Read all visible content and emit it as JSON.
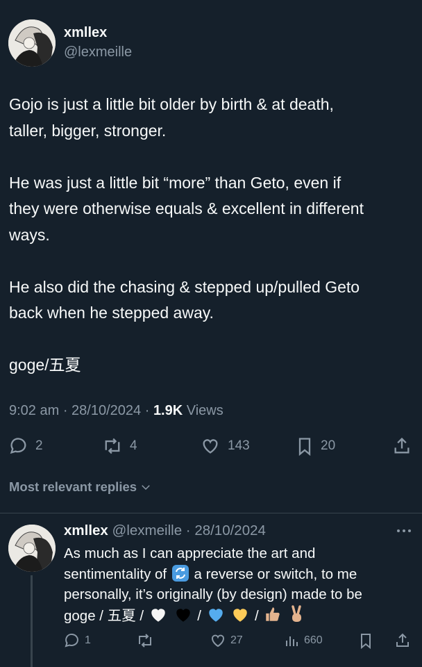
{
  "tweet": {
    "author_name": "xmllex",
    "author_handle": "@lexmeille",
    "text": "Gojo is just a little bit older by birth & at death,\ntaller, bigger, stronger.\n\nHe was just a little bit “more” than Geto, even if\nthey were otherwise equals & excellent in different\nways.\n\nHe also did the chasing & stepped up/pulled Geto\nback when he stepped away.\n\ngoge/五夏",
    "time": "9:02 am",
    "date": "28/10/2024",
    "views_count": "1.9K",
    "views_label": "Views",
    "replies": "2",
    "reposts": "4",
    "likes": "143",
    "bookmarks": "20"
  },
  "replies_section": {
    "sort_label": "Most relevant replies"
  },
  "reply": {
    "author_name": "xmllex",
    "author_handle": "@lexmeille",
    "date": "28/10/2024",
    "line1": "As much as I can appreciate the art and",
    "line2a": "sentimentality of",
    "line2b": "a reverse or switch, to me",
    "line3": "personally, it’s originally (by design) made to be",
    "line4a": "goge / 五夏 /",
    "replies": "1",
    "likes": "27",
    "views": "660"
  },
  "colors": {
    "background": "#15202b",
    "text": "#f7f9f9",
    "secondary": "#8b98a5",
    "divider": "#38444d"
  },
  "icons": [
    "reply-icon",
    "repost-icon",
    "like-icon",
    "bookmark-icon",
    "share-icon",
    "chevron-down-icon",
    "more-icon",
    "views-icon"
  ]
}
